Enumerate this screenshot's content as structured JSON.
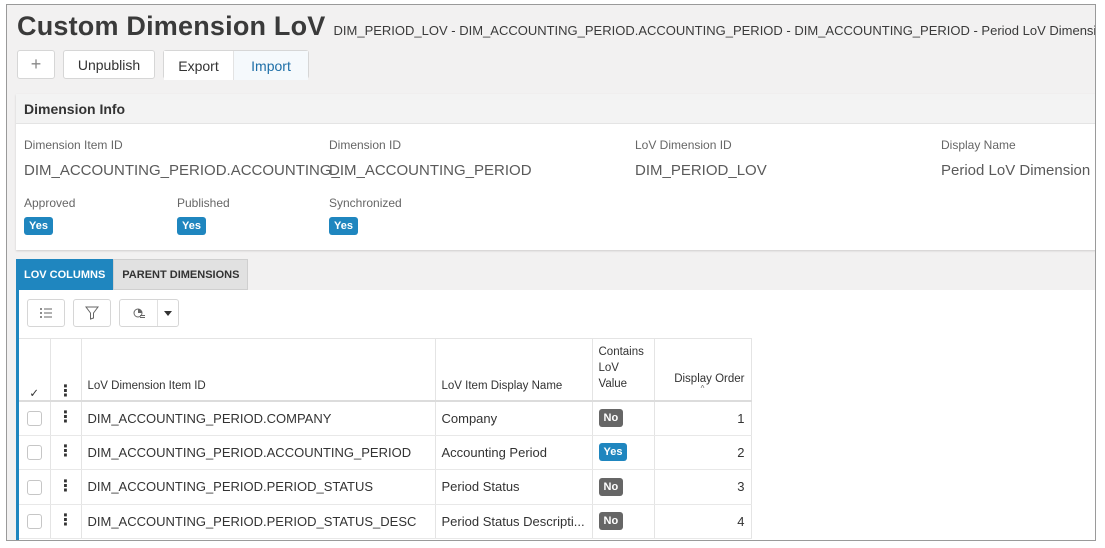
{
  "header": {
    "title": "Custom Dimension LoV",
    "subtitle": "DIM_PERIOD_LOV - DIM_ACCOUNTING_PERIOD.ACCOUNTING_PERIOD - DIM_ACCOUNTING_PERIOD - Period LoV Dimension"
  },
  "toolbar": {
    "new_label": "+",
    "unpublish_label": "Unpublish",
    "export_label": "Export",
    "import_label": "Import"
  },
  "dimension_info": {
    "heading": "Dimension Info",
    "fields": [
      {
        "label": "Dimension Item ID",
        "value": "DIM_ACCOUNTING_PERIOD.ACCOUNTING_..."
      },
      {
        "label": "Dimension ID",
        "value": "DIM_ACCOUNTING_PERIOD"
      },
      {
        "label": "LoV Dimension ID",
        "value": "DIM_PERIOD_LOV"
      },
      {
        "label": "Display Name",
        "value": "Period LoV Dimension"
      }
    ],
    "flags": [
      {
        "label": "Approved",
        "value": "Yes"
      },
      {
        "label": "Published",
        "value": "Yes"
      },
      {
        "label": "Synchronized",
        "value": "Yes"
      }
    ]
  },
  "tabs": [
    {
      "label": "LOV COLUMNS",
      "active": true
    },
    {
      "label": "PARENT DIMENSIONS",
      "active": false
    }
  ],
  "grid": {
    "columns": {
      "check": "✓",
      "menu": "⋮",
      "item_id": "LoV Dimension Item ID",
      "display_name": "LoV Item Display Name",
      "contains_l1": "Contains",
      "contains_l2": "LoV",
      "contains_l3": "Value",
      "order": "Display Order",
      "sort_indicator": "^"
    },
    "rows": [
      {
        "item_id": "DIM_ACCOUNTING_PERIOD.COMPANY",
        "display_name": "Company",
        "contains": "No",
        "order": "1"
      },
      {
        "item_id": "DIM_ACCOUNTING_PERIOD.ACCOUNTING_PERIOD",
        "display_name": "Accounting Period",
        "contains": "Yes",
        "order": "2"
      },
      {
        "item_id": "DIM_ACCOUNTING_PERIOD.PERIOD_STATUS",
        "display_name": "Period Status",
        "contains": "No",
        "order": "3"
      },
      {
        "item_id": "DIM_ACCOUNTING_PERIOD.PERIOD_STATUS_DESC",
        "display_name": "Period Status Descripti...",
        "contains": "No",
        "order": "4"
      }
    ]
  },
  "colors": {
    "accent": "#1f86bf",
    "badge_no": "#666666"
  }
}
